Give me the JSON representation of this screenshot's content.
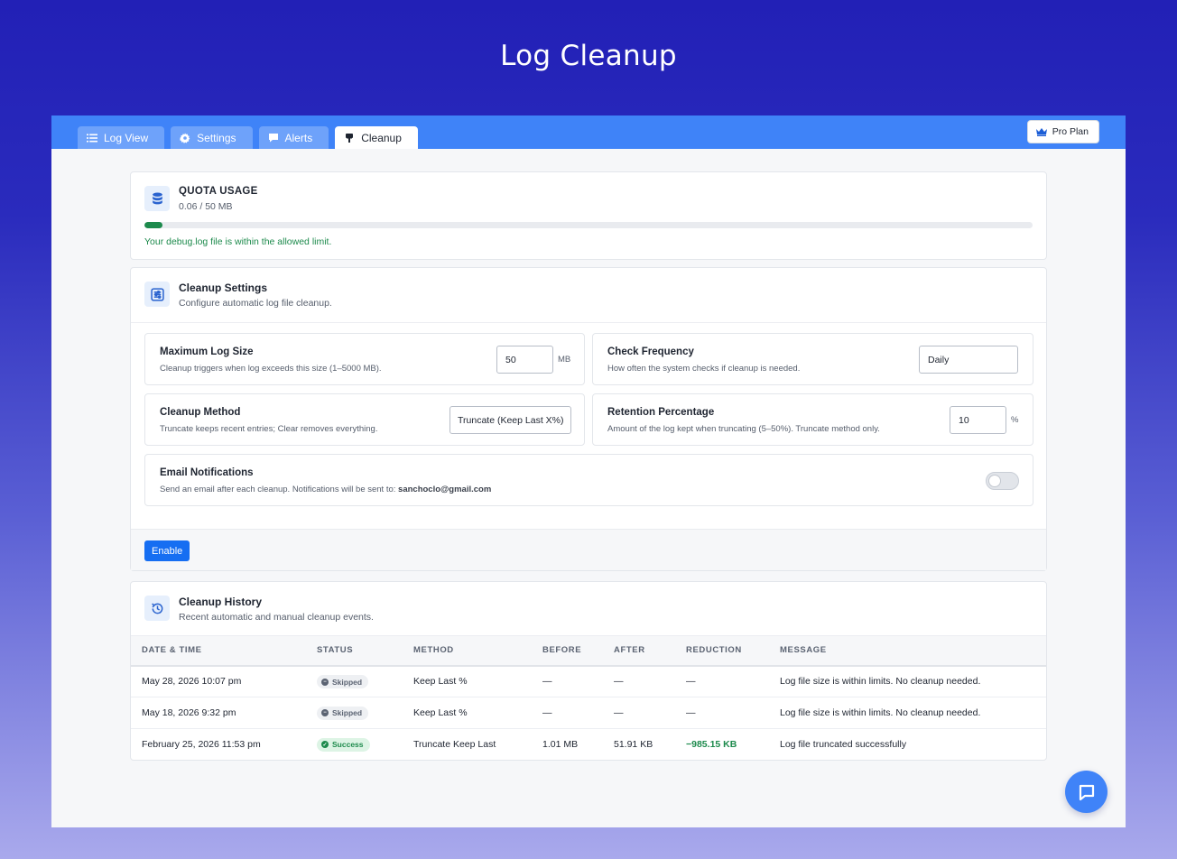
{
  "hero": {
    "title": "Log Cleanup"
  },
  "tabs": [
    {
      "label": "Log View",
      "icon": "list-icon"
    },
    {
      "label": "Settings",
      "icon": "gear-icon"
    },
    {
      "label": "Alerts",
      "icon": "chat-icon"
    },
    {
      "label": "Cleanup",
      "icon": "broom-icon",
      "active": true
    }
  ],
  "pro": {
    "label": "Pro Plan",
    "icon": "crown-icon"
  },
  "quota": {
    "title": "QUOTA USAGE",
    "usage": "0.06 / 50 MB",
    "fraction": 0.02,
    "message": "Your debug.log file is within the allowed limit."
  },
  "cleanup_settings": {
    "title": "Cleanup Settings",
    "subtitle": "Configure automatic log file cleanup.",
    "max_size": {
      "title": "Maximum Log Size",
      "desc": "Cleanup triggers when log exceeds this size (1–5000 MB).",
      "value": "50",
      "unit": "MB"
    },
    "frequency": {
      "title": "Check Frequency",
      "desc": "How often the system checks if cleanup is needed.",
      "value": "Daily"
    },
    "method": {
      "title": "Cleanup Method",
      "desc": "Truncate keeps recent entries; Clear removes everything.",
      "value": "Truncate (Keep Last X%)"
    },
    "retention": {
      "title": "Retention Percentage",
      "desc": "Amount of the log kept when truncating (5–50%). Truncate method only.",
      "value": "10",
      "unit": "%"
    },
    "email": {
      "title": "Email Notifications",
      "desc": "Send an email after each cleanup. Notifications will be sent to:",
      "address": "sanchoclo@gmail.com"
    },
    "enable_label": "Enable"
  },
  "history": {
    "title": "Cleanup History",
    "subtitle": "Recent automatic and manual cleanup events.",
    "columns": [
      "DATE & TIME",
      "STATUS",
      "METHOD",
      "BEFORE",
      "AFTER",
      "REDUCTION",
      "MESSAGE"
    ],
    "rows": [
      {
        "date": "May 28, 2026 10:07 pm",
        "status": "Skipped",
        "method": "Keep Last %",
        "before": "—",
        "after": "—",
        "reduction": "—",
        "message": "Log file size is within limits. No cleanup needed."
      },
      {
        "date": "May 18, 2026 9:32 pm",
        "status": "Skipped",
        "method": "Keep Last %",
        "before": "—",
        "after": "—",
        "reduction": "—",
        "message": "Log file size is within limits. No cleanup needed."
      },
      {
        "date": "February 25, 2026 11:53 pm",
        "status": "Success",
        "method": "Truncate Keep Last",
        "before": "1.01 MB",
        "after": "51.91 KB",
        "reduction": "−985.15 KB",
        "message": "Log file truncated successfully"
      }
    ]
  },
  "colors": {
    "accent": "#3f83f8",
    "success": "#1d8a4c",
    "primary_button": "#166ef2"
  }
}
